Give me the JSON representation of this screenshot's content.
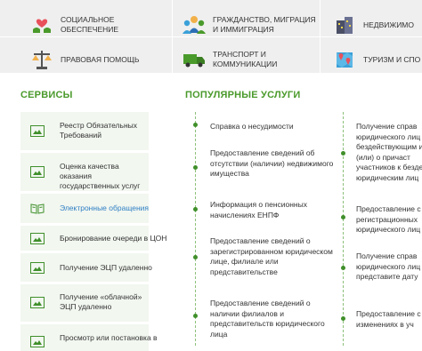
{
  "categories": [
    {
      "label": "Социальное обеспечение",
      "icon": "heart-hands-icon"
    },
    {
      "label": "Гражданство, миграция и иммиграция",
      "icon": "people-group-icon"
    },
    {
      "label": "Недвижимо",
      "icon": "buildings-icon"
    },
    {
      "label": "Правовая помощь",
      "icon": "scales-icon"
    },
    {
      "label": "Транспорт и коммуникации",
      "icon": "truck-icon"
    },
    {
      "label": "Туризм и спо",
      "icon": "map-pins-icon"
    }
  ],
  "services_title": "Сервисы",
  "popular_title": "Популярные услуги",
  "services": [
    {
      "label": "Реестр Обязательных Требований",
      "icon": "document-image-icon",
      "active": false
    },
    {
      "label": "Оценка качества оказания государственных услуг",
      "icon": "document-image-icon",
      "active": false
    },
    {
      "label": "Электронные обращения",
      "icon": "open-book-icon",
      "active": true
    },
    {
      "label": "Бронирование очереди в ЦОН",
      "icon": "document-image-icon",
      "active": false
    },
    {
      "label": "Получение ЭЦП удаленно",
      "icon": "document-image-icon",
      "active": false
    },
    {
      "label": "Получение «облачной» ЭЦП удаленно",
      "icon": "document-image-icon",
      "active": false
    },
    {
      "label": "Просмотр или постановка в",
      "icon": "document-image-icon",
      "active": false
    }
  ],
  "popular_col1": [
    "Справка о несудимости",
    "Предоставление сведений об отсутствии (наличии) недвижимого имущества",
    "Информация о пенсионных начислениях ЕНПФ",
    "Предоставление сведений о зарегистрированном юридическом лице, филиале или представительстве",
    "Предоставление сведений о наличии филиалов и представительств юридического лица"
  ],
  "popular_col2": [
    "Получение справ юридического лиц бездействующим и (или) о причаст участников к безде юридическим лиц",
    "Предоставление с регистрационных юридического лиц",
    "Получение справ юридического лиц или представите дату",
    "Предоставление с изменениях в уч"
  ],
  "colors": {
    "accent": "#4a9a2b",
    "link": "#2f7fc4",
    "service_bg": "#f2f7f0",
    "category_bg": "#efefef"
  }
}
